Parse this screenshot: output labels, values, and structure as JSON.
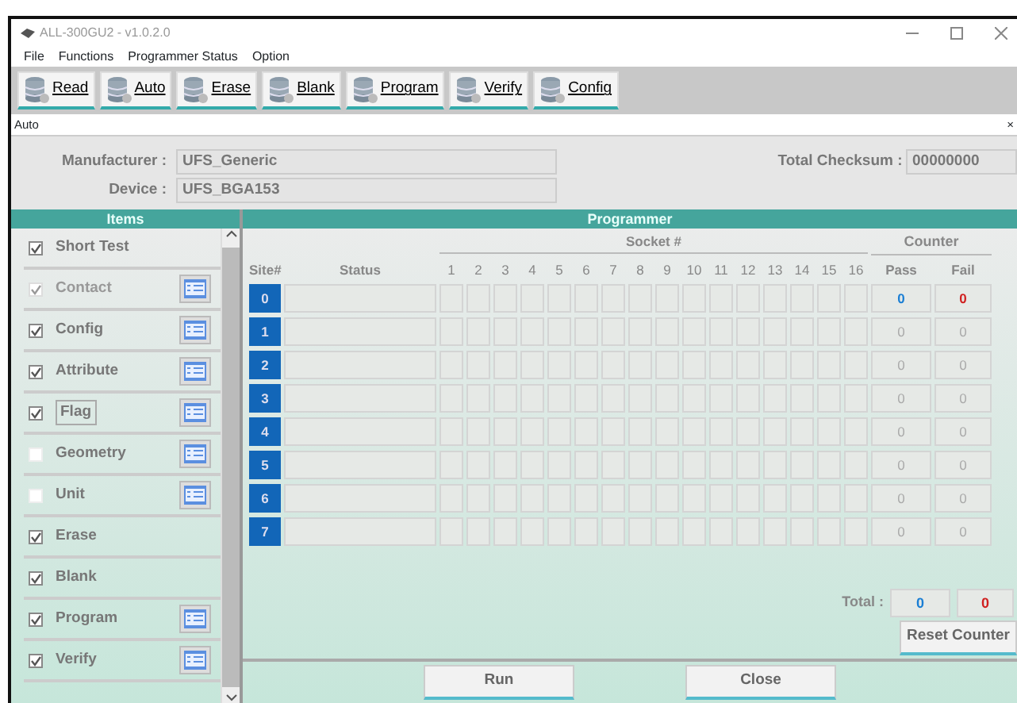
{
  "window": {
    "title": "ALL-300GU2 - v1.0.2.0"
  },
  "menu": [
    "File",
    "Functions",
    "Programmer Status",
    "Option"
  ],
  "toolbar": [
    "Read",
    "Auto",
    "Erase",
    "Blank",
    "Program",
    "Verify",
    "Config"
  ],
  "subwindow": {
    "title": "Auto",
    "close": "×"
  },
  "info": {
    "manufacturer_label": "Manufacturer :",
    "manufacturer": "UFS_Generic",
    "device_label": "Device :",
    "device": "UFS_BGA153",
    "checksum_label": "Total Checksum :",
    "checksum": "00000000"
  },
  "items_panel": {
    "title": "Items",
    "items": [
      {
        "label": "Short Test",
        "kind": "plain",
        "checked": true,
        "disabled": false,
        "focused": false
      },
      {
        "label": "Contact",
        "kind": "settings",
        "checked": true,
        "disabled": true,
        "focused": false
      },
      {
        "label": "Config",
        "kind": "settings",
        "checked": true,
        "disabled": false,
        "focused": false
      },
      {
        "label": "Attribute",
        "kind": "settings",
        "checked": true,
        "disabled": false,
        "focused": false
      },
      {
        "label": "Flag",
        "kind": "settings",
        "checked": true,
        "disabled": false,
        "focused": true
      },
      {
        "label": "Geometry",
        "kind": "settings",
        "checked": false,
        "disabled": false,
        "focused": false
      },
      {
        "label": "Unit",
        "kind": "settings",
        "checked": false,
        "disabled": false,
        "focused": false
      },
      {
        "label": "Erase",
        "kind": "plain",
        "checked": true,
        "disabled": false,
        "focused": false
      },
      {
        "label": "Blank",
        "kind": "plain",
        "checked": true,
        "disabled": false,
        "focused": false
      },
      {
        "label": "Program",
        "kind": "settings",
        "checked": true,
        "disabled": false,
        "focused": false
      },
      {
        "label": "Verify",
        "kind": "settings",
        "checked": true,
        "disabled": false,
        "focused": false
      }
    ]
  },
  "programmer": {
    "title": "Programmer",
    "socket_heading": "Socket #",
    "counter_heading": "Counter",
    "site_heading": "Site#",
    "status_heading": "Status",
    "sockets": [
      "1",
      "2",
      "3",
      "4",
      "5",
      "6",
      "7",
      "8",
      "9",
      "10",
      "11",
      "12",
      "13",
      "14",
      "15",
      "16"
    ],
    "pass_heading": "Pass",
    "fail_heading": "Fail",
    "sites": [
      {
        "site": "0",
        "pass": "0",
        "fail": "0",
        "active": true
      },
      {
        "site": "1",
        "pass": "0",
        "fail": "0",
        "active": false
      },
      {
        "site": "2",
        "pass": "0",
        "fail": "0",
        "active": false
      },
      {
        "site": "3",
        "pass": "0",
        "fail": "0",
        "active": false
      },
      {
        "site": "4",
        "pass": "0",
        "fail": "0",
        "active": false
      },
      {
        "site": "5",
        "pass": "0",
        "fail": "0",
        "active": false
      },
      {
        "site": "6",
        "pass": "0",
        "fail": "0",
        "active": false
      },
      {
        "site": "7",
        "pass": "0",
        "fail": "0",
        "active": false
      }
    ],
    "total_label": "Total :",
    "total_pass": "0",
    "total_fail": "0",
    "reset": "Reset Counter"
  },
  "buttons": [
    "Run",
    "Close"
  ]
}
